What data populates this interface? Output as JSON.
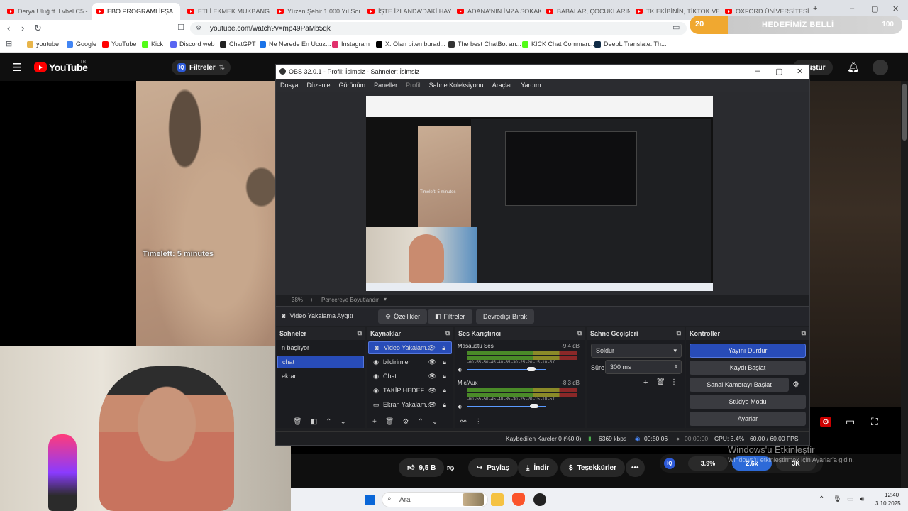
{
  "browser": {
    "tabs": [
      {
        "label": "Derya Uluğ ft. Lvbel C5 - Ç"
      },
      {
        "label": "EBO PROGRAMI İFŞA...",
        "active": true
      },
      {
        "label": "ETLİ EKMEK MUKBANG //"
      },
      {
        "label": "Yüzen Şehir 1.000 Yıl Sonr"
      },
      {
        "label": "İŞTE İZLANDA'DAKİ HAYAT"
      },
      {
        "label": "ADANA'NIN İMZA SOKAK"
      },
      {
        "label": "BABALAR, ÇOCUKLARININ"
      },
      {
        "label": "TK EKİBİNİN, TİKTOK VE R"
      },
      {
        "label": "OXFORD ÜNİVERSİTESİ Y"
      }
    ],
    "new_tab": "+",
    "window_controls": {
      "minimize": "–",
      "maximize": "▢",
      "close": "✕"
    },
    "url": "youtube.com/watch?v=mp49PaMb5qk",
    "bookmarks": [
      {
        "label": "youtube",
        "color": "#e8b54a"
      },
      {
        "label": "Google",
        "color": "#4285f4"
      },
      {
        "label": "YouTube",
        "color": "#ff0000"
      },
      {
        "label": "Kick",
        "color": "#53fc18"
      },
      {
        "label": "Discord web",
        "color": "#5865f2"
      },
      {
        "label": "ChatGPT",
        "color": "#222222"
      },
      {
        "label": "Ne Nerede En Ucuz...",
        "color": "#1a73e8"
      },
      {
        "label": "Instagram",
        "color": "#e1306c"
      },
      {
        "label": "X. Olan biten burad...",
        "color": "#000000"
      },
      {
        "label": "The best ChatBot an...",
        "color": "#333333"
      },
      {
        "label": "KICK Chat Comman...",
        "color": "#53fc18"
      },
      {
        "label": "DeepL Translate: Th...",
        "color": "#0f2b46"
      }
    ]
  },
  "goal": {
    "count": "20",
    "label": "HEDEFİMİZ BELLİ",
    "target": "100"
  },
  "youtube": {
    "logo": "YouTube",
    "logo_country": "TR",
    "filter_chip": "Filtreler",
    "create_button": "Oluştur",
    "timeleft": "Timeleft: 5 minutes",
    "like_count": "9,5 B",
    "share_label": "Paylaş",
    "download_label": "İndir",
    "thanks_label": "Teşekkürler",
    "more_label": "•••"
  },
  "obs": {
    "title": "OBS 32.0.1 - Profil: İsimsiz - Sahneler: İsimsiz",
    "menu": [
      "Dosya",
      "Düzenle",
      "Görünüm",
      "Paneller",
      "Profil",
      "Sahne Koleksiyonu",
      "Araçlar",
      "Yardım"
    ],
    "zoom": "38%",
    "fit_window": "Pencereye Boyutlandır",
    "preview_timeleft": "Timeleft: 5 minutes",
    "selected_source": "Video Yakalama Aygıtı",
    "properties_button": "Özellikler",
    "filters_button": "Filtreler",
    "deactivate_button": "Devredışı Bırak",
    "scenes": {
      "title": "Sahneler",
      "items": [
        {
          "label": "n başlıyor"
        },
        {
          "label": "chat",
          "selected": true
        },
        {
          "label": "ekran"
        }
      ]
    },
    "sources": {
      "title": "Kaynaklar",
      "items": [
        {
          "label": "Video Yakalam...",
          "selected": true
        },
        {
          "label": "bildirimler"
        },
        {
          "label": "Chat"
        },
        {
          "label": "TAKİP HEDEF"
        },
        {
          "label": "Ekran Yakalam..."
        }
      ]
    },
    "mixer": {
      "title": "Ses Karıştırıcı",
      "scale": "-60 -55 -50 -45 -40 -35 -30 -25 -20 -15 -10 -5 0",
      "channels": [
        {
          "name": "Masaüstü Ses",
          "db": "-9.4 dB",
          "level": 0.82
        },
        {
          "name": "Mic/Aux",
          "db": "-8.3 dB",
          "level": 0.85
        }
      ]
    },
    "transitions": {
      "title": "Sahne Geçişleri",
      "selected": "Soldur",
      "duration_label": "Süre",
      "duration": "300 ms"
    },
    "controls": {
      "title": "Kontroller",
      "buttons": [
        "Yayını Durdur",
        "Kaydı Başlat",
        "Sanal Kamerayı Başlat",
        "Stüdyo Modu",
        "Ayarlar"
      ]
    },
    "status": {
      "dropped": "Kaybedilen Kareler 0 (%0.0)",
      "bitrate": "6369 kbps",
      "live_time": "00:50:06",
      "rec_time": "00:00:00",
      "cpu": "CPU: 3.4%",
      "fps": "60.00 / 60.00 FPS"
    }
  },
  "windows": {
    "activate_title": "Windows'u Etkinleştir",
    "activate_sub": "Windows'u etkinleştirmek için Ayarlar'a gidin.",
    "search_placeholder": "Ara",
    "time": "12:40",
    "date": "3.10.2025"
  },
  "perf_widget": {
    "ic": "IQ",
    "seg1": "3.9%",
    "seg2": "2.6x",
    "seg3": "3K"
  }
}
